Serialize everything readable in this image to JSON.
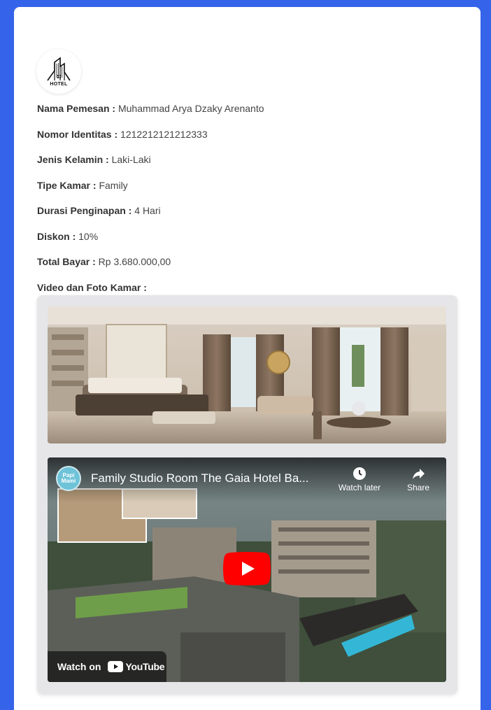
{
  "logo": {
    "icon": "hotel-building-icon",
    "text": "HOTEL"
  },
  "booking": {
    "nama_pemesan": {
      "label": "Nama Pemesan",
      "value": "Muhammad Arya Dzaky Arenanto"
    },
    "nomor_identitas": {
      "label": "Nomor Identitas",
      "value": "1212212121212333"
    },
    "jenis_kelamin": {
      "label": "Jenis Kelamin",
      "value": "Laki-Laki"
    },
    "tipe_kamar": {
      "label": "Tipe Kamar",
      "value": "Family"
    },
    "durasi": {
      "label": "Durasi Penginapan",
      "value": "4 Hari"
    },
    "diskon": {
      "label": "Diskon",
      "value": "10%"
    },
    "total": {
      "label": "Total Bayar",
      "value": "Rp 3.680.000,00"
    },
    "media_label": "Video dan Foto Kamar :",
    "separator": " : "
  },
  "video": {
    "title": "Family Studio Room The Gaia Hotel Ba...",
    "channel_avatar_text": "Papi Mami",
    "watch_later": "Watch later",
    "share": "Share",
    "watch_on": "Watch on",
    "youtube": "YouTube"
  },
  "colors": {
    "background": "#3563e9",
    "card": "#ffffff",
    "youtube_red": "#ff0000"
  }
}
